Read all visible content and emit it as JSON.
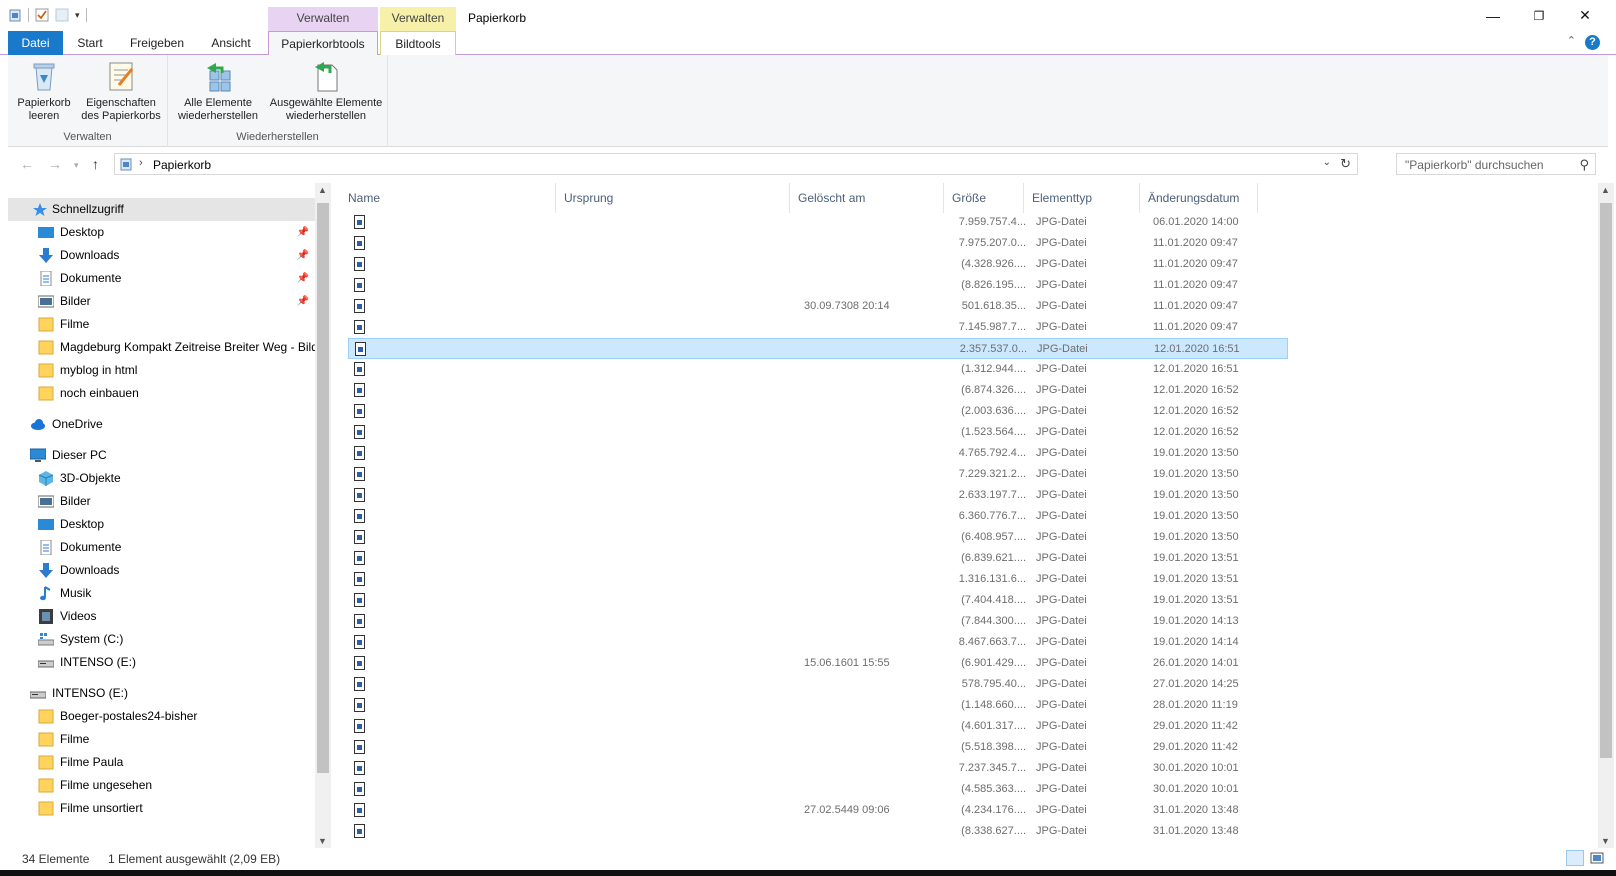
{
  "titlebar": {
    "title": "Papierkorb",
    "ctx_manage_recycle": "Verwalten",
    "ctx_manage_picture": "Verwalten",
    "minimize": "—",
    "restore": "❐",
    "close": "✕"
  },
  "tabs": {
    "file": "Datei",
    "start": "Start",
    "share": "Freigeben",
    "view": "Ansicht",
    "recycle_tools": "Papierkorbtools",
    "picture_tools": "Bildtools",
    "help": "?"
  },
  "ribbon": {
    "empty_bin": "Papierkorb leeren",
    "bin_properties": "Eigenschaften des Papierkorbs",
    "group_manage": "Verwalten",
    "restore_all": "Alle Elemente wiederherstellen",
    "restore_selected": "Ausgewählte Elemente wiederherstellen",
    "group_restore": "Wiederherstellen"
  },
  "address": {
    "path": "Papierkorb",
    "search_placeholder": "\"Papierkorb\" durchsuchen"
  },
  "nav": {
    "quick_access": "Schnellzugriff",
    "qa_items": [
      "Desktop",
      "Downloads",
      "Dokumente",
      "Bilder",
      "Filme",
      "Magdeburg Kompakt Zeitreise Breiter Weg - Bilder",
      "myblog in html",
      "noch einbauen"
    ],
    "onedrive": "OneDrive",
    "this_pc": "Dieser PC",
    "pc_items": [
      "3D-Objekte",
      "Bilder",
      "Desktop",
      "Dokumente",
      "Downloads",
      "Musik",
      "Videos",
      "System (C:)",
      "INTENSO (E:)"
    ],
    "drive": "INTENSO (E:)",
    "drive_items": [
      "Boeger-postales24-bisher",
      "Filme",
      "Filme Paula",
      "Filme ungesehen",
      "Filme unsortiert"
    ]
  },
  "columns": {
    "name": "Name",
    "origin": "Ursprung",
    "deleted": "Gelöscht am",
    "size": "Größe",
    "type": "Elementtyp",
    "modified": "Änderungsdatum"
  },
  "files": [
    {
      "deleted": "",
      "size": "7.959.757.4...",
      "type": "JPG-Datei",
      "modified": "06.01.2020 14:00"
    },
    {
      "deleted": "",
      "size": "7.975.207.0...",
      "type": "JPG-Datei",
      "modified": "11.01.2020 09:47"
    },
    {
      "deleted": "",
      "size": "(4.328.926....",
      "type": "JPG-Datei",
      "modified": "11.01.2020 09:47"
    },
    {
      "deleted": "",
      "size": "(8.826.195....",
      "type": "JPG-Datei",
      "modified": "11.01.2020 09:47"
    },
    {
      "deleted": "30.09.7308 20:14",
      "size": "501.618.35...",
      "type": "JPG-Datei",
      "modified": "11.01.2020 09:47"
    },
    {
      "deleted": "",
      "size": "7.145.987.7...",
      "type": "JPG-Datei",
      "modified": "11.01.2020 09:47"
    },
    {
      "deleted": "",
      "size": "2.357.537.0...",
      "type": "JPG-Datei",
      "modified": "12.01.2020 16:51",
      "selected": true
    },
    {
      "deleted": "",
      "size": "(1.312.944....",
      "type": "JPG-Datei",
      "modified": "12.01.2020 16:51"
    },
    {
      "deleted": "",
      "size": "(6.874.326....",
      "type": "JPG-Datei",
      "modified": "12.01.2020 16:52"
    },
    {
      "deleted": "",
      "size": "(2.003.636....",
      "type": "JPG-Datei",
      "modified": "12.01.2020 16:52"
    },
    {
      "deleted": "",
      "size": "(1.523.564....",
      "type": "JPG-Datei",
      "modified": "12.01.2020 16:52"
    },
    {
      "deleted": "",
      "size": "4.765.792.4...",
      "type": "JPG-Datei",
      "modified": "19.01.2020 13:50"
    },
    {
      "deleted": "",
      "size": "7.229.321.2...",
      "type": "JPG-Datei",
      "modified": "19.01.2020 13:50"
    },
    {
      "deleted": "",
      "size": "2.633.197.7...",
      "type": "JPG-Datei",
      "modified": "19.01.2020 13:50"
    },
    {
      "deleted": "",
      "size": "6.360.776.7...",
      "type": "JPG-Datei",
      "modified": "19.01.2020 13:50"
    },
    {
      "deleted": "",
      "size": "(6.408.957....",
      "type": "JPG-Datei",
      "modified": "19.01.2020 13:50"
    },
    {
      "deleted": "",
      "size": "(6.839.621....",
      "type": "JPG-Datei",
      "modified": "19.01.2020 13:51"
    },
    {
      "deleted": "",
      "size": "1.316.131.6...",
      "type": "JPG-Datei",
      "modified": "19.01.2020 13:51"
    },
    {
      "deleted": "",
      "size": "(7.404.418....",
      "type": "JPG-Datei",
      "modified": "19.01.2020 13:51"
    },
    {
      "deleted": "",
      "size": "(7.844.300....",
      "type": "JPG-Datei",
      "modified": "19.01.2020 14:13"
    },
    {
      "deleted": "",
      "size": "8.467.663.7...",
      "type": "JPG-Datei",
      "modified": "19.01.2020 14:14"
    },
    {
      "deleted": "15.06.1601 15:55",
      "size": "(6.901.429....",
      "type": "JPG-Datei",
      "modified": "26.01.2020 14:01"
    },
    {
      "deleted": "",
      "size": "578.795.40...",
      "type": "JPG-Datei",
      "modified": "27.01.2020 14:25"
    },
    {
      "deleted": "",
      "size": "(1.148.660....",
      "type": "JPG-Datei",
      "modified": "28.01.2020 11:19"
    },
    {
      "deleted": "",
      "size": "(4.601.317....",
      "type": "JPG-Datei",
      "modified": "29.01.2020 11:42"
    },
    {
      "deleted": "",
      "size": "(5.518.398....",
      "type": "JPG-Datei",
      "modified": "29.01.2020 11:42"
    },
    {
      "deleted": "",
      "size": "7.237.345.7...",
      "type": "JPG-Datei",
      "modified": "30.01.2020 10:01"
    },
    {
      "deleted": "",
      "size": "(4.585.363....",
      "type": "JPG-Datei",
      "modified": "30.01.2020 10:01"
    },
    {
      "deleted": "27.02.5449 09:06",
      "size": "(4.234.176....",
      "type": "JPG-Datei",
      "modified": "31.01.2020 13:48"
    },
    {
      "deleted": "",
      "size": "(8.338.627....",
      "type": "JPG-Datei",
      "modified": "31.01.2020 13:48"
    }
  ],
  "status": {
    "count": "34 Elemente",
    "selection": "1 Element ausgewählt (2,09 EB)"
  },
  "colors": {
    "file_tab": "#1979ca",
    "selected_row": "#cce8ff",
    "context_purple": "#e8d3f2",
    "context_yellow": "#f6f0a8"
  }
}
